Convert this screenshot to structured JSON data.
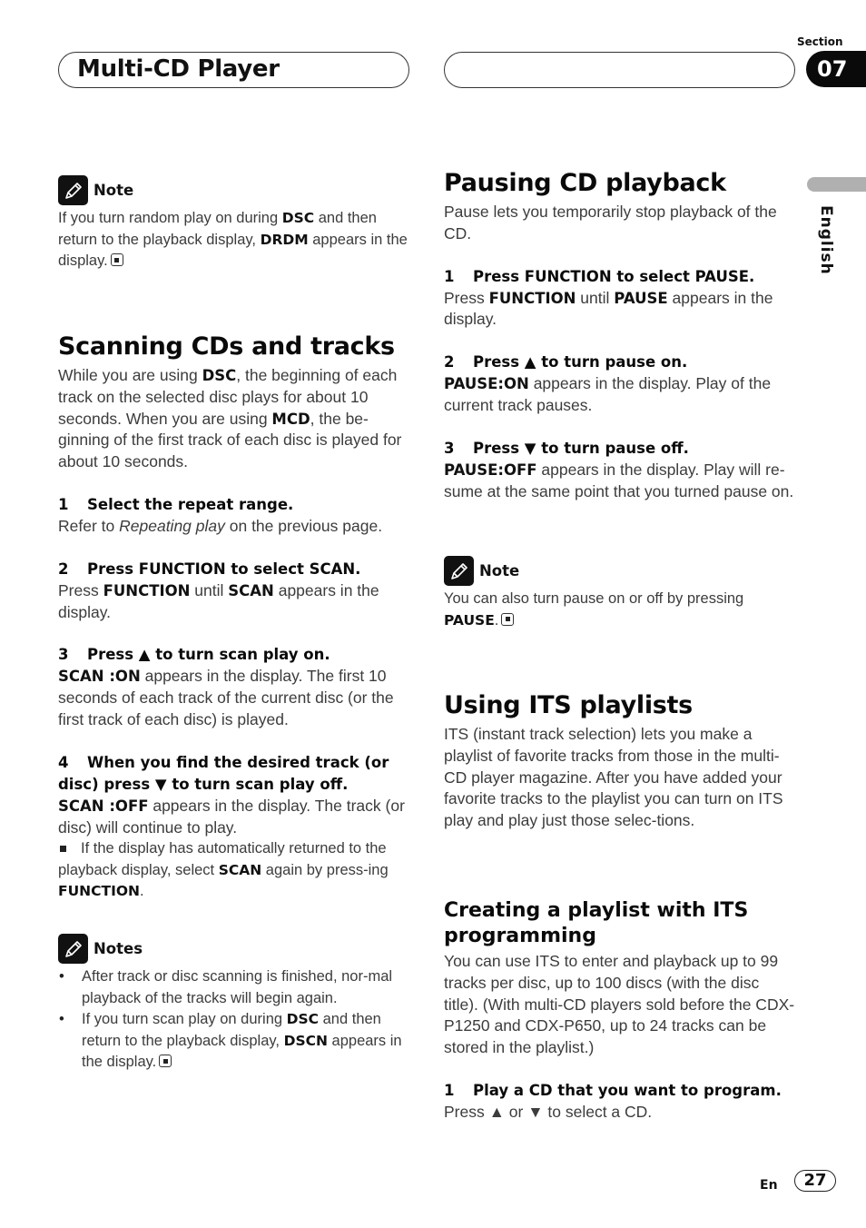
{
  "header": {
    "title": "Multi-CD Player",
    "section_label": "Section",
    "section_number": "07",
    "language": "English"
  },
  "left": {
    "note1": {
      "icon": "pencil-note-icon",
      "title": "Note",
      "parts": [
        "If you turn random play on during ",
        "DSC",
        " and then return to the playback display, ",
        "DRDM",
        " appears in the display."
      ]
    },
    "scanning": {
      "title": "Scanning CDs and tracks",
      "intro": [
        "While you are using ",
        "DSC",
        ", the beginning of each track on the selected disc plays for about 10 seconds. When you are using ",
        "MCD",
        ", the be-ginning of the first track of each disc is played for about 10 seconds."
      ],
      "steps": [
        {
          "num": "1",
          "head": "Select the repeat range.",
          "body": [
            "Refer to ",
            "Repeating play",
            " on the previous page."
          ]
        },
        {
          "num": "2",
          "head": "Press FUNCTION to select SCAN.",
          "body": [
            "Press ",
            "FUNCTION",
            " until ",
            "SCAN",
            " appears in the display."
          ]
        },
        {
          "num": "3",
          "head": "Press ▲ to turn scan play on.",
          "body": [
            "SCAN :ON",
            " appears in the display. The first 10 seconds of each track of the current disc (or the first track of each disc) is played."
          ]
        },
        {
          "num": "4",
          "head": "When you find the desired track (or disc) press ▼ to turn scan play off.",
          "body": [
            "SCAN :OFF",
            " appears in the display. The track (or disc) will continue to play."
          ],
          "extra": [
            "If the display has automatically returned to the playback display, select ",
            "SCAN",
            " again by press-ing ",
            "FUNCTION",
            "."
          ]
        }
      ]
    },
    "notes2": {
      "icon": "pencil-note-icon",
      "title": "Notes",
      "items": [
        [
          "After track or disc scanning is finished, nor-mal playback of the tracks will begin again."
        ],
        [
          "If you turn scan play on during ",
          "DSC",
          " and then return to the playback display, ",
          "DSCN",
          " appears in the display."
        ]
      ]
    }
  },
  "right": {
    "pausing": {
      "title": "Pausing CD playback",
      "intro": "Pause lets you temporarily stop playback of the CD.",
      "steps": [
        {
          "num": "1",
          "head": "Press FUNCTION to select PAUSE.",
          "body": [
            "Press ",
            "FUNCTION",
            " until ",
            "PAUSE",
            " appears in the display."
          ]
        },
        {
          "num": "2",
          "head": "Press ▲ to turn pause on.",
          "body": [
            "PAUSE:ON",
            " appears in the display. Play of the current track pauses."
          ]
        },
        {
          "num": "3",
          "head": "Press ▼ to turn pause off.",
          "body": [
            "PAUSE:OFF",
            " appears in the display. Play will re-sume at the same point that you turned pause on."
          ]
        }
      ]
    },
    "note3": {
      "icon": "pencil-note-icon",
      "title": "Note",
      "parts": [
        "You can also turn pause on or off by pressing ",
        "PAUSE",
        "."
      ]
    },
    "its": {
      "title": "Using ITS playlists",
      "intro": "ITS (instant track selection) lets you make a playlist of favorite tracks from those in the multi-CD player magazine. After you have added your favorite tracks to the playlist you can turn on ITS play and play just those selec-tions."
    },
    "creating": {
      "title": "Creating a playlist with ITS programming",
      "intro": "You can use ITS to enter and playback up to 99 tracks per disc, up to 100 discs (with the disc title). (With multi-CD players sold before the CDX-P1250 and CDX-P650, up to 24 tracks can be stored in the playlist.)",
      "steps": [
        {
          "num": "1",
          "head": "Play a CD that you want to program.",
          "body": "Press ▲ or ▼ to select a CD."
        }
      ]
    }
  },
  "footer": {
    "lang_code": "En",
    "page_number": "27"
  }
}
